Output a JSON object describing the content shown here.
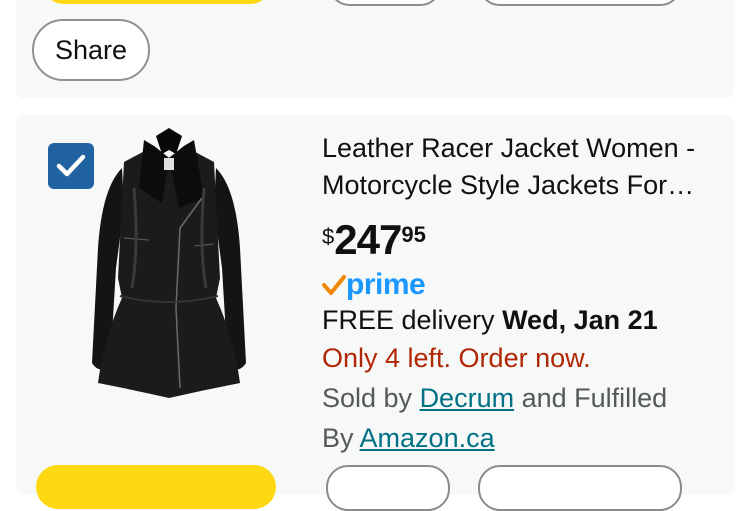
{
  "top_card": {
    "share_label": "Share"
  },
  "item": {
    "selected": true,
    "title": "Leather Racer Jacket Women - Motorcycle Style Jackets For…",
    "price": {
      "symbol": "$",
      "whole": "247",
      "fraction": "95"
    },
    "prime_label": "prime",
    "delivery": {
      "prefix": "FREE delivery ",
      "date": "Wed, Jan 21"
    },
    "stock_notice": "Only 4 left. Order now.",
    "sold_by_prefix": "Sold by ",
    "seller": "Decrum",
    "fulfilled_text": " and Fulfilled",
    "by_prefix": "By ",
    "fulfiller": "Amazon.ca"
  },
  "colors": {
    "checkbox": "#2162a1",
    "prime_blue": "#1a98ff",
    "prime_check": "#f08804",
    "stock_red": "#b12704",
    "link": "#007185",
    "add_to_cart_yellow": "#ffd814"
  }
}
